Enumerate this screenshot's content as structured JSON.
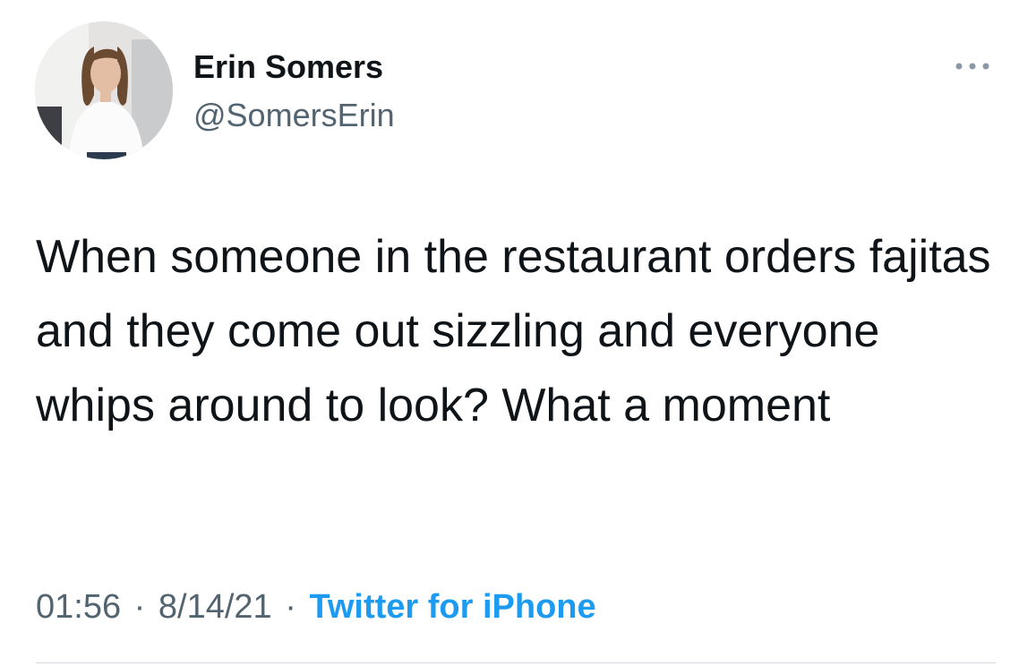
{
  "author": {
    "display_name": "Erin Somers",
    "handle": "@SomersErin"
  },
  "tweet": {
    "text": "When someone in the restaurant orders fajitas and they come out sizzling and everyone whips around to look? What a moment",
    "time": "01:56",
    "date": "8/14/21",
    "separator": "·",
    "source": "Twitter for iPhone"
  },
  "icons": {
    "more": "more-horizontal-icon",
    "avatar": "profile-photo"
  },
  "colors": {
    "primary_text": "#0f1419",
    "secondary_text": "#536471",
    "link": "#1d9bf0",
    "divider": "#cfd9de"
  }
}
